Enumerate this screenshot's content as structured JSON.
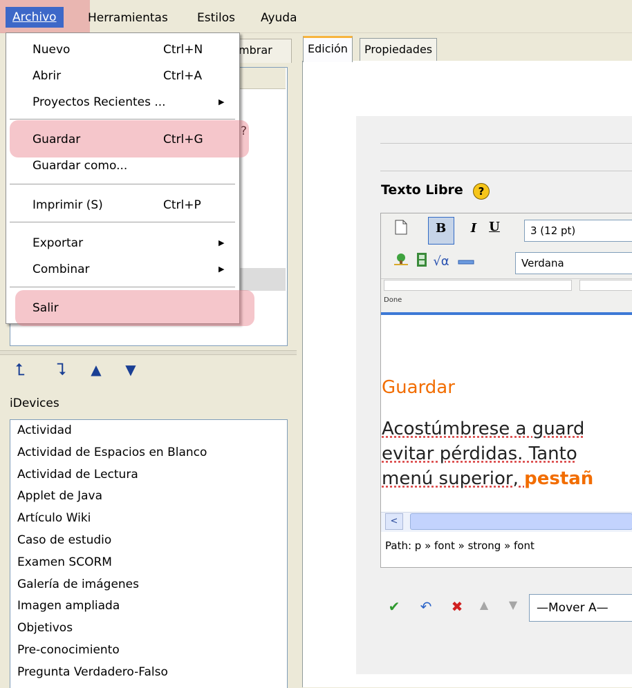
{
  "menubar": {
    "items": [
      "Archivo",
      "Herramientas",
      "Estilos",
      "Ayuda"
    ]
  },
  "archivo_menu": {
    "items": [
      {
        "label": "Nuevo",
        "shortcut": "Ctrl+N"
      },
      {
        "label": "Abrir",
        "shortcut": "Ctrl+A"
      },
      {
        "label": "Proyectos Recientes ...",
        "submenu_icon": "▶"
      },
      {
        "label": "Guardar",
        "shortcut": "Ctrl+G"
      },
      {
        "label": "Guardar como...",
        "shortcut": ""
      },
      {
        "label": "Imprimir (S)",
        "shortcut": "Ctrl+P"
      },
      {
        "label": "Exportar",
        "submenu_icon": "▶"
      },
      {
        "label": "Combinar",
        "submenu_icon": "▶"
      },
      {
        "label": "Salir",
        "shortcut": ""
      }
    ]
  },
  "outline": {
    "tab_partial": "mbrar",
    "question_partial": "?"
  },
  "nav_arrows": {
    "up_left": "⮤",
    "down_right": "⮧",
    "up": "▲",
    "down": "▼"
  },
  "idevices": {
    "label": "iDevices",
    "items": [
      "Actividad",
      "Actividad de Espacios en Blanco",
      "Actividad de Lectura",
      "Applet de Java",
      "Artículo Wiki",
      "Caso de estudio",
      "Examen SCORM",
      "Galería de imágenes",
      "Imagen ampliada",
      "Objetivos",
      "Pre-conocimiento",
      "Pregunta Verdadero-Falso"
    ]
  },
  "tabs": [
    "Edición",
    "Propiedades"
  ],
  "editor": {
    "block_title": "Texto Libre",
    "help": "?",
    "size_value": "3 (12 pt)",
    "font_value": "Verdana",
    "done": "Done",
    "heading": "Guardar",
    "line1": "Acostúmbrese a guard",
    "line2": "evitar pérdidas. Tanto",
    "line3_plain": "menú superior, ",
    "line3_bold": "pestañ",
    "scroll_left": "<",
    "path": "Path: p » font » strong » font",
    "move_label": "—Mover A—"
  },
  "toolbar_icons": {
    "new": "new-document-icon",
    "bold": "B",
    "italic": "I",
    "underline": "U"
  },
  "colors": {
    "menu_selected": "#3d68c8",
    "highlight": "#e67882",
    "heading_orange": "#f26d00",
    "tab_accent": "#f7b43e"
  }
}
